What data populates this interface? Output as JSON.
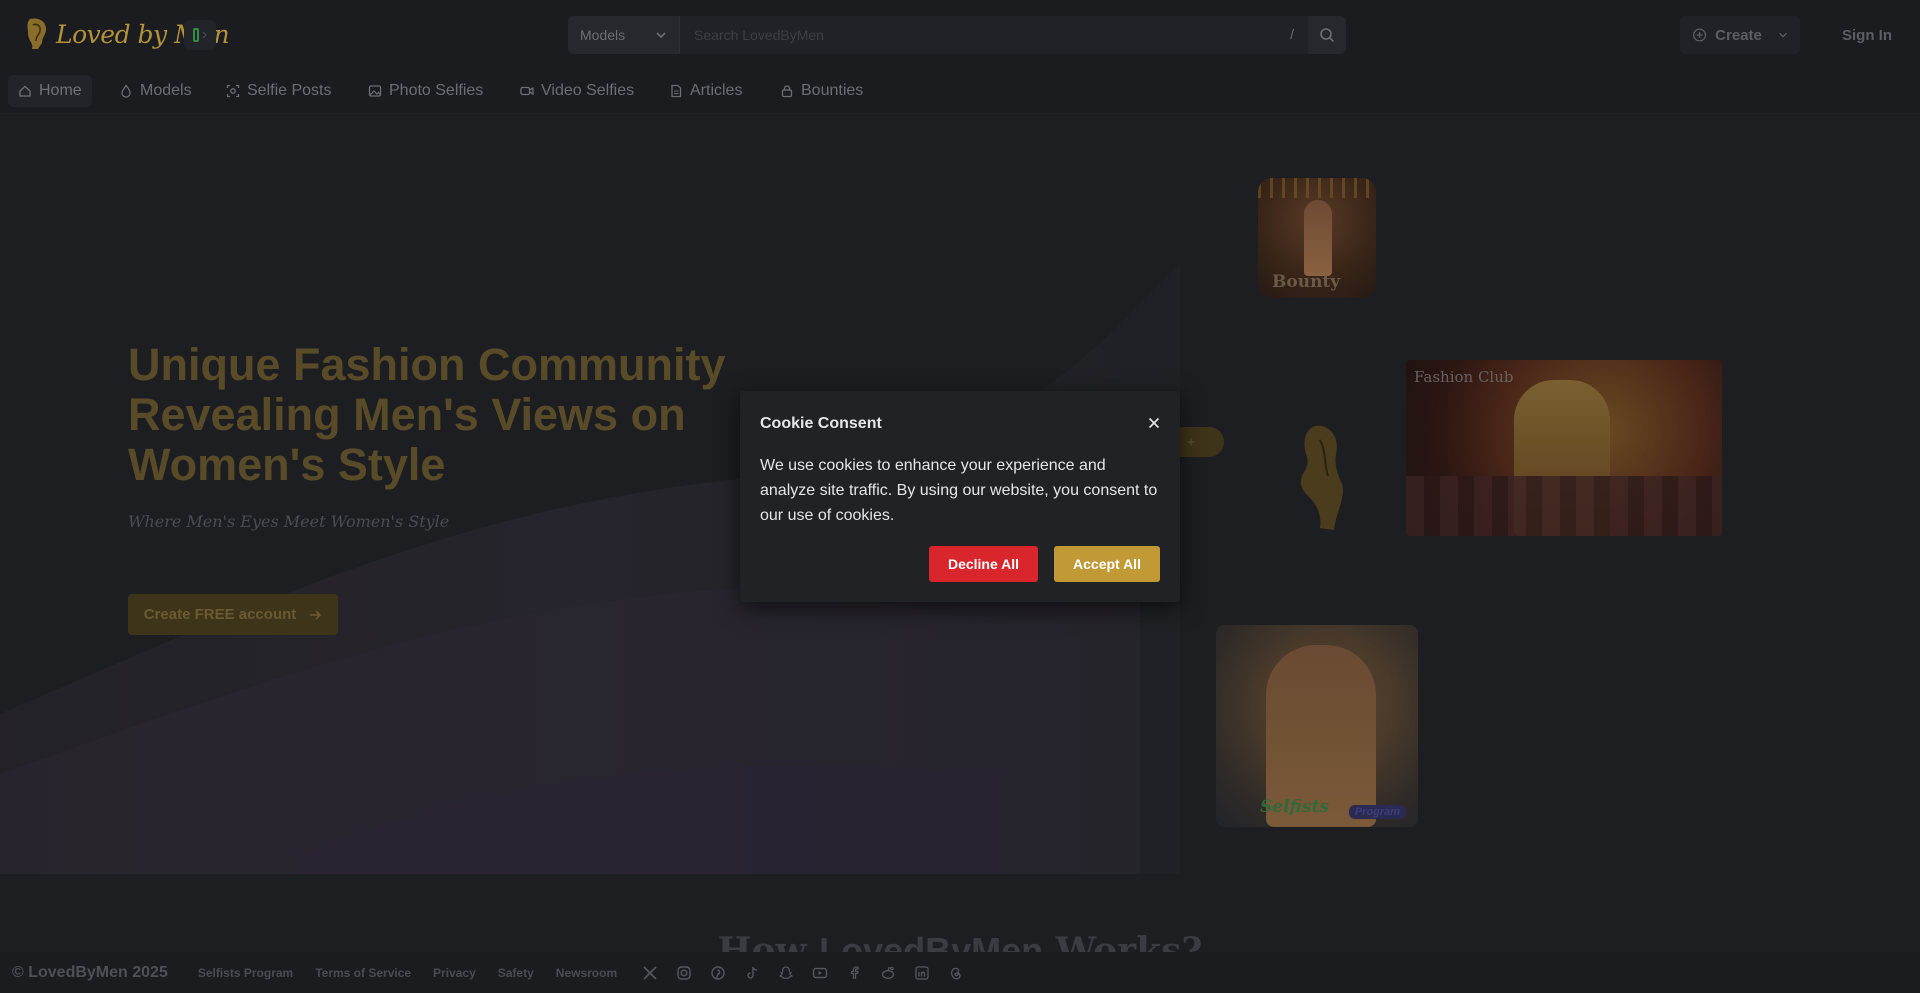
{
  "header": {
    "logo_text": "Loved by Men",
    "search": {
      "category_selected": "Models",
      "placeholder": "Search LovedByMen",
      "shortcut_key": "/"
    },
    "create_label": "Create",
    "signin_label": "Sign In"
  },
  "nav": {
    "items": [
      {
        "label": "Home",
        "icon": "home-icon",
        "active": true
      },
      {
        "label": "Models",
        "icon": "flame-icon"
      },
      {
        "label": "Selfie Posts",
        "icon": "selfie-icon"
      },
      {
        "label": "Photo Selfies",
        "icon": "image-icon"
      },
      {
        "label": "Video Selfies",
        "icon": "video-icon"
      },
      {
        "label": "Articles",
        "icon": "document-icon"
      },
      {
        "label": "Bounties",
        "icon": "lock-icon"
      }
    ]
  },
  "hero": {
    "title": "Unique Fashion Community Revealing Men's Views on Women's Style",
    "subtitle": "Where Men's Eyes Meet Women's Style",
    "cta_label": "Create FREE account",
    "cards": {
      "bounty_label": "Bounty",
      "fashion_label": "Fashion Club",
      "selfists_label": "Selfists",
      "selfists_tag": "Program"
    }
  },
  "how_it_works": {
    "prefix": "How ",
    "brand": "LovedByMen",
    "suffix": " Works?"
  },
  "footer": {
    "copyright": "© LovedByMen 2025",
    "links": [
      "Selfists Program",
      "Terms of Service",
      "Privacy",
      "Safety",
      "Newsroom"
    ],
    "social_icons": [
      "x-icon",
      "instagram-icon",
      "pinterest-icon",
      "tiktok-icon",
      "snapchat-icon",
      "youtube-icon",
      "facebook-icon",
      "reddit-icon",
      "linkedin-icon",
      "threads-icon"
    ]
  },
  "cookie_modal": {
    "title": "Cookie Consent",
    "body": "We use cookies to enhance your experience and analyze site traffic. By using our website, you consent to our use of cookies.",
    "decline_label": "Decline All",
    "accept_label": "Accept All"
  },
  "colors": {
    "gold": "#c19a35",
    "decline_red": "#d9252c",
    "page_bg": "#1d1e22"
  }
}
